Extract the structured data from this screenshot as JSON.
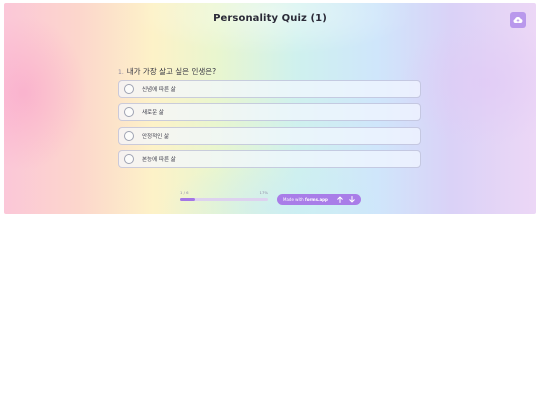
{
  "header": {
    "title": "Personality Quiz (1)",
    "cloud_icon": "cloud-upload-icon"
  },
  "question": {
    "number": "1.",
    "text": "내가 가장 살고 싶은 인생은?"
  },
  "options": [
    {
      "label": "신념에 따른 삶"
    },
    {
      "label": "새로운 삶"
    },
    {
      "label": "안정적인 삶"
    },
    {
      "label": "본능에 따른 삶"
    }
  ],
  "progress": {
    "label": "1 / 6",
    "percent_label": "17%",
    "fraction": 0.17
  },
  "footer": {
    "made_with": "Made with",
    "brand": "forms.app",
    "up_icon": "arrow-up-icon",
    "down_icon": "arrow-down-icon"
  },
  "colors": {
    "accent": "#a97de8",
    "cloud_button": "#b998ec"
  }
}
